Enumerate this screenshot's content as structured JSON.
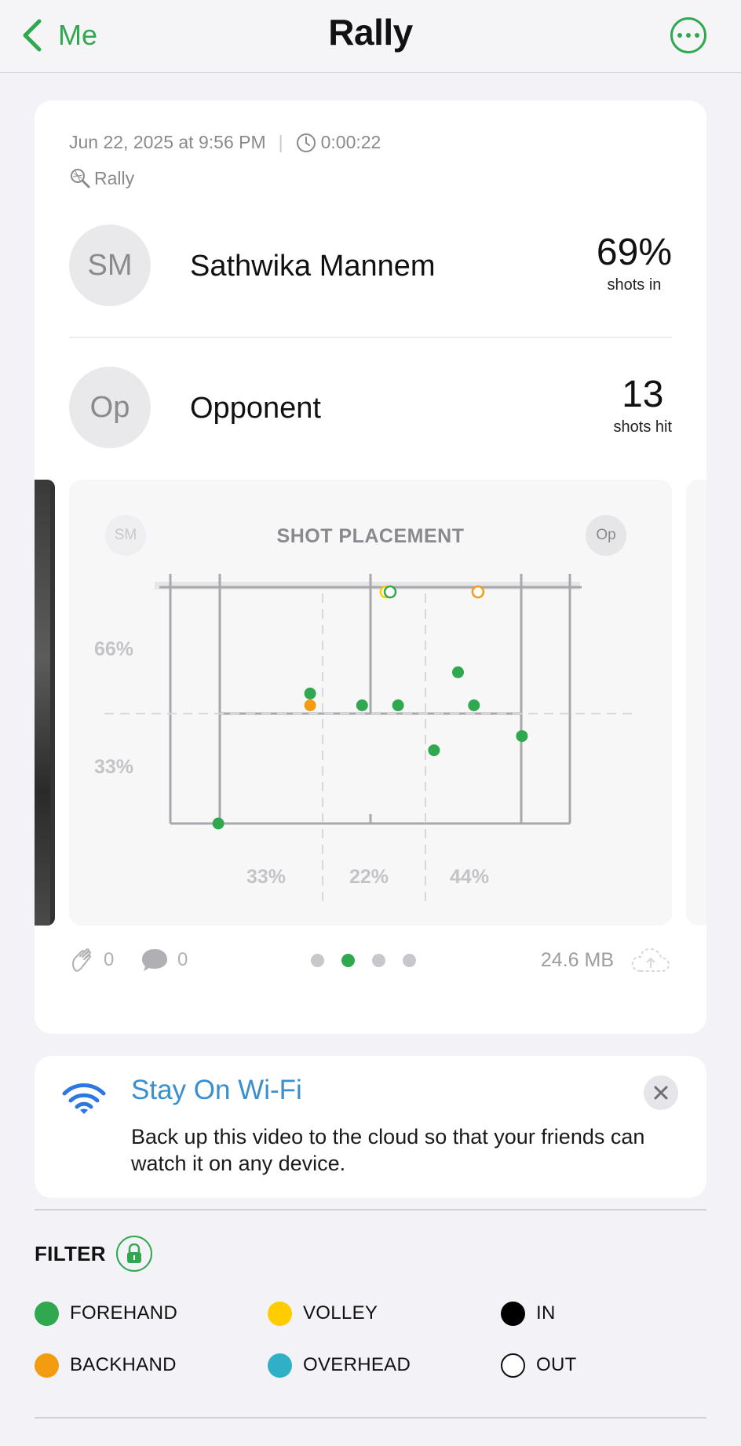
{
  "nav": {
    "back_label": "Me",
    "title": "Rally"
  },
  "session": {
    "datetime": "Jun 22, 2025 at 9:56 PM",
    "duration": "0:00:22",
    "activity": "Rally"
  },
  "players": [
    {
      "initials": "SM",
      "name": "Sathwika Mannem",
      "stat_value": "69%",
      "stat_label": "shots in"
    },
    {
      "initials": "Op",
      "name": "Opponent",
      "stat_value": "13",
      "stat_label": "shots hit"
    }
  ],
  "chart_data": {
    "type": "scatter",
    "title": "SHOT PLACEMENT",
    "left_avatar": "SM",
    "right_avatar": "Op",
    "depth_labels": [
      "66%",
      "33%"
    ],
    "width_labels": [
      "33%",
      "22%",
      "44%"
    ],
    "colors": {
      "forehand": "#2fa84f",
      "backhand": "#f39c12"
    },
    "shots": [
      {
        "x": 0.35,
        "y": 0.55,
        "type": "forehand",
        "in": true
      },
      {
        "x": 0.35,
        "y": 0.5,
        "type": "backhand",
        "in": true
      },
      {
        "x": 0.48,
        "y": 0.5,
        "type": "forehand",
        "in": true
      },
      {
        "x": 0.57,
        "y": 0.5,
        "type": "forehand",
        "in": true
      },
      {
        "x": 0.72,
        "y": 0.64,
        "type": "forehand",
        "in": true
      },
      {
        "x": 0.76,
        "y": 0.5,
        "type": "forehand",
        "in": true
      },
      {
        "x": 0.66,
        "y": 0.31,
        "type": "forehand",
        "in": true
      },
      {
        "x": 0.88,
        "y": 0.37,
        "type": "forehand",
        "in": true
      },
      {
        "x": 0.12,
        "y": 0.0,
        "type": "forehand",
        "in": true
      },
      {
        "x": 0.54,
        "y": 0.98,
        "type": "volley",
        "in": false
      },
      {
        "x": 0.55,
        "y": 0.98,
        "type": "forehand",
        "in": false
      },
      {
        "x": 0.77,
        "y": 0.98,
        "type": "backhand",
        "in": false
      }
    ]
  },
  "footer": {
    "likes": "0",
    "comments": "0",
    "pages": 4,
    "active_page": 2,
    "file_size": "24.6 MB"
  },
  "wifi_banner": {
    "title": "Stay On Wi-Fi",
    "body": "Back up this video to the cloud so that your friends can watch it on any device."
  },
  "filter": {
    "label": "FILTER",
    "items": [
      {
        "label": "FOREHAND",
        "color": "#2fa84f"
      },
      {
        "label": "VOLLEY",
        "color": "#ffcc00"
      },
      {
        "label": "IN",
        "color": "#000000"
      },
      {
        "label": "BACKHAND",
        "color": "#f39c12"
      },
      {
        "label": "OVERHEAD",
        "color": "#30b0c7"
      },
      {
        "label": "OUT",
        "color": "#ffffff"
      }
    ]
  }
}
